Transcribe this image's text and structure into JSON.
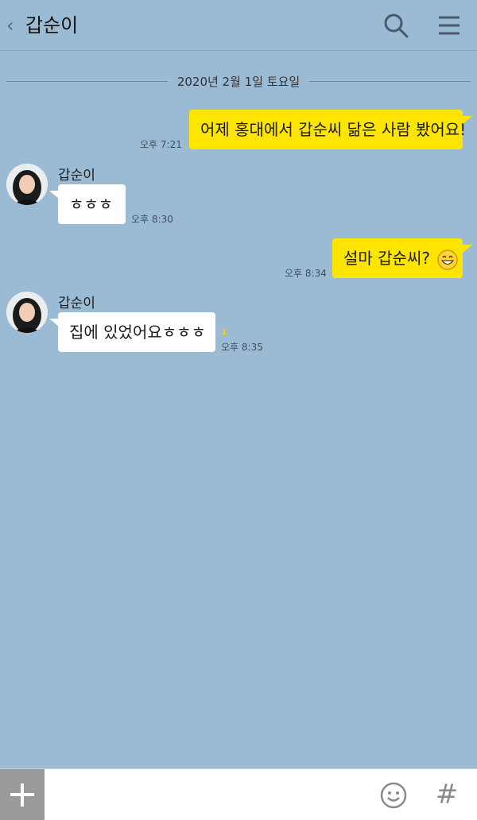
{
  "header": {
    "title": "갑순이",
    "back_icon": "chevron-left-icon",
    "search_icon": "search-icon",
    "menu_icon": "hamburger-menu-icon"
  },
  "date_divider": "2020년 2월 1일 토요일",
  "messages": [
    {
      "from": "me",
      "text": "어제 홍대에서 갑순씨 닮은 사람 봤어요!",
      "time": "오후 7:21"
    },
    {
      "from": "other",
      "sender": "갑순이",
      "text": "ㅎㅎㅎ",
      "time": "오후 8:30"
    },
    {
      "from": "me",
      "text": "설마 갑순씨?",
      "emoji": "grin-emoji-icon",
      "time": "오후 8:34"
    },
    {
      "from": "other",
      "sender": "갑순이",
      "text": "집에 있었어요ㅎㅎㅎ",
      "unread": "1",
      "time": "오후 8:35"
    }
  ],
  "footer": {
    "plus_icon": "plus-icon",
    "emoji_icon": "smiley-icon",
    "hash_icon": "#"
  },
  "colors": {
    "background": "#9bbbd4",
    "my_bubble": "#fee500",
    "other_bubble": "#ffffff"
  }
}
